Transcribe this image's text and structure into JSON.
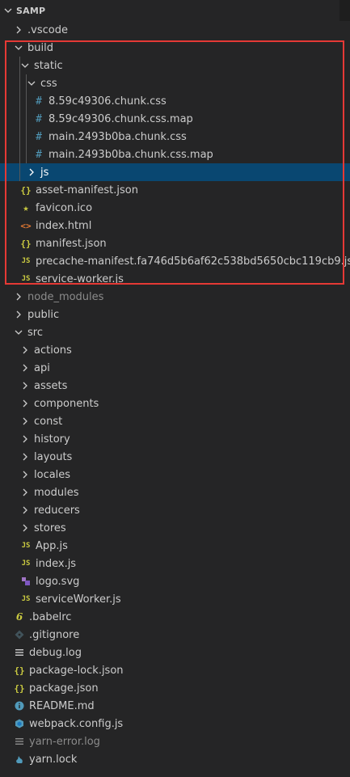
{
  "explorer": {
    "root_title": "SAMP"
  },
  "tree": [
    {
      "label": "vscode_placeholder"
    }
  ],
  "items": {
    "vscode": ".vscode",
    "build": "build",
    "static": "static",
    "css": "css",
    "css1": "8.59c49306.chunk.css",
    "css2": "8.59c49306.chunk.css.map",
    "css3": "main.2493b0ba.chunk.css",
    "css4": "main.2493b0ba.chunk.css.map",
    "js": "js",
    "asset_manifest": "asset-manifest.json",
    "favicon": "favicon.ico",
    "index_html": "index.html",
    "manifest": "manifest.json",
    "precache": "precache-manifest.fa746d5b6af62c538bd5650cbc119cb9.js",
    "service_worker": "service-worker.js",
    "node_modules": "node_modules",
    "public": "public",
    "src": "src",
    "actions": "actions",
    "api": "api",
    "assets": "assets",
    "components": "components",
    "const": "const",
    "history": "history",
    "layouts": "layouts",
    "locales": "locales",
    "modules": "modules",
    "reducers": "reducers",
    "stores": "stores",
    "app_js": "App.js",
    "index_js": "index.js",
    "logo_svg": "logo.svg",
    "service_worker_js": "serviceWorker.js",
    "babelrc": ".babelrc",
    "gitignore": ".gitignore",
    "debug_log": "debug.log",
    "package_lock": "package-lock.json",
    "package_json": "package.json",
    "readme": "README.md",
    "webpack": "webpack.config.js",
    "yarn_error": "yarn-error.log",
    "yarn_lock": "yarn.lock"
  },
  "icons": {
    "js_text": "JS",
    "json_text": "{}",
    "css_text": "#",
    "html_text": "<>",
    "star_text": "★",
    "babel_text": "6"
  },
  "colors": {
    "background": "#252526",
    "selected": "#094771",
    "highlight_border": "#e53935",
    "js_icon": "#cbcb41",
    "css_icon": "#519aba",
    "html_icon": "#e37933"
  }
}
